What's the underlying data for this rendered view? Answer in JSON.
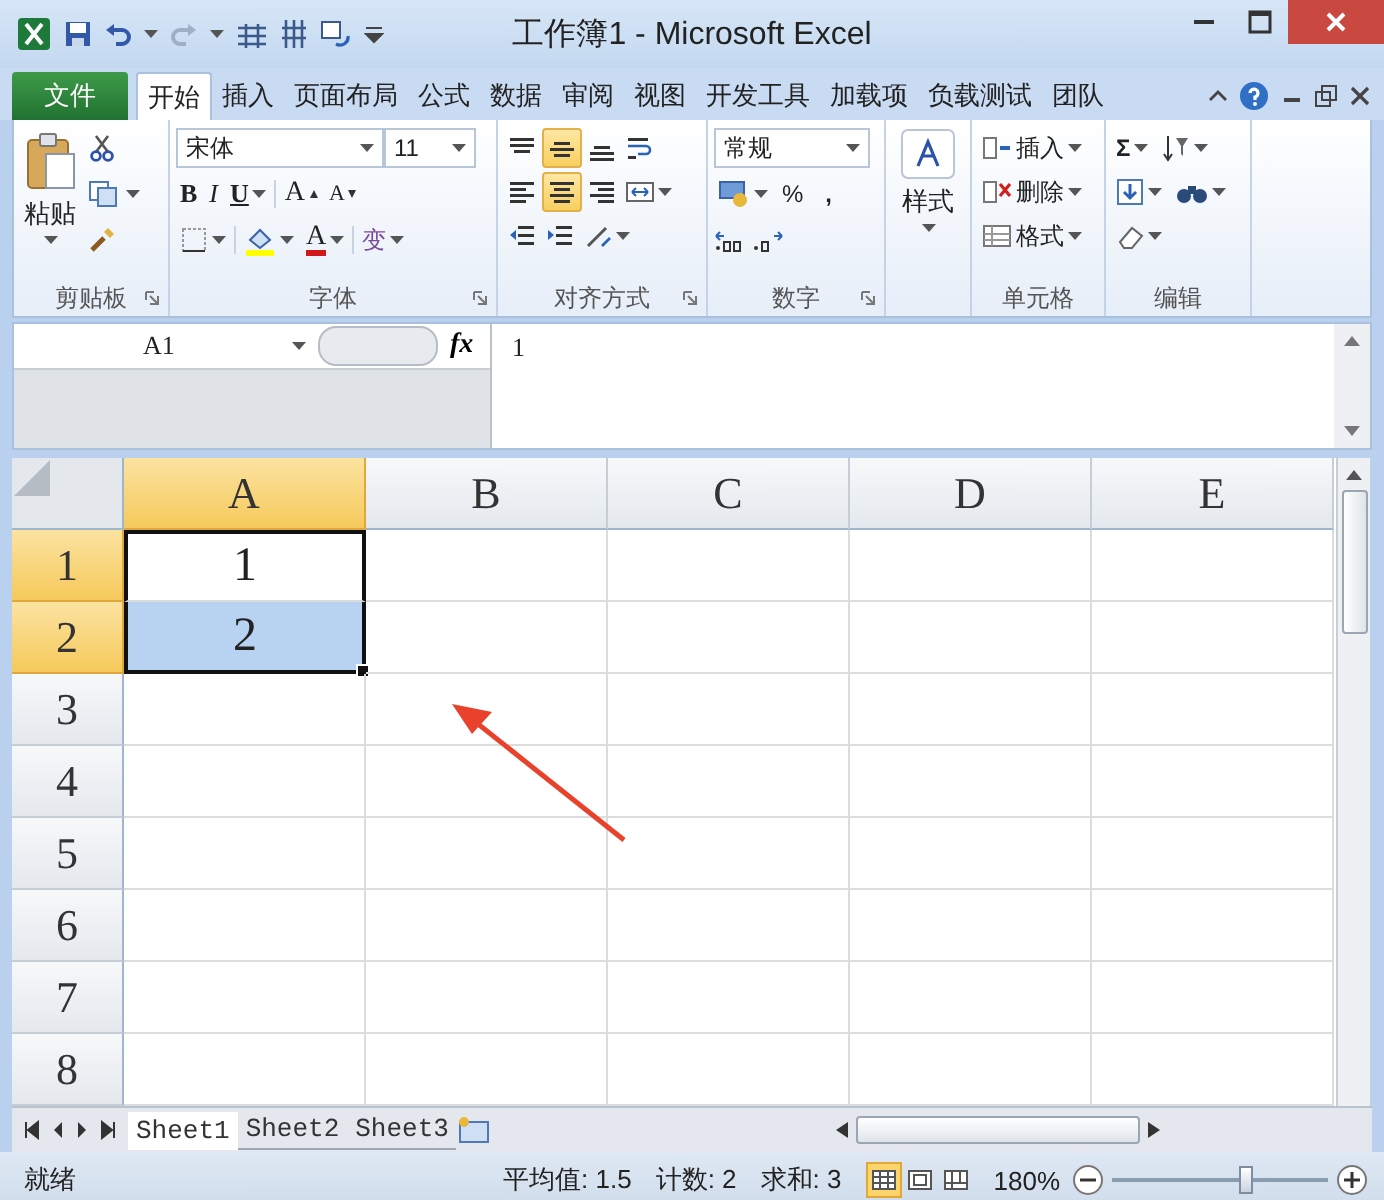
{
  "window": {
    "title": "工作簿1 - Microsoft Excel"
  },
  "file_tab": {
    "label": "文件"
  },
  "tabs": [
    {
      "label": "开始",
      "selected": true
    },
    {
      "label": "插入",
      "selected": false
    },
    {
      "label": "页面布局",
      "selected": false
    },
    {
      "label": "公式",
      "selected": false
    },
    {
      "label": "数据",
      "selected": false
    },
    {
      "label": "审阅",
      "selected": false
    },
    {
      "label": "视图",
      "selected": false
    },
    {
      "label": "开发工具",
      "selected": false
    },
    {
      "label": "加载项",
      "selected": false
    },
    {
      "label": "负载测试",
      "selected": false
    },
    {
      "label": "团队",
      "selected": false
    }
  ],
  "ribbon": {
    "clipboard": {
      "paste": "粘贴",
      "label": "剪贴板"
    },
    "font": {
      "name": "宋体",
      "size": "11",
      "bold": "B",
      "italic": "I",
      "underline": "U",
      "grow": "A",
      "shrink": "A",
      "font_color": "A",
      "phonetic": "变",
      "label": "字体"
    },
    "alignment": {
      "buttons": [
        {
          "kind": "top",
          "selected": false
        },
        {
          "kind": "middle",
          "selected": true
        },
        {
          "kind": "bottom",
          "selected": false
        },
        {
          "kind": "wrap",
          "selected": false
        },
        {
          "kind": "left",
          "selected": false
        },
        {
          "kind": "center",
          "selected": true
        },
        {
          "kind": "right",
          "selected": false
        },
        {
          "kind": "merge",
          "selected": false
        },
        {
          "kind": "outdent",
          "selected": false
        },
        {
          "kind": "indent",
          "selected": false
        },
        {
          "kind": "orientation",
          "selected": false
        }
      ],
      "label": "对齐方式"
    },
    "number": {
      "format": "常规",
      "percent": "%",
      "comma": ",",
      "label": "数字"
    },
    "styles": {
      "button": "样式"
    },
    "cells": {
      "buttons": [
        {
          "kind": "insert",
          "label": "插入"
        },
        {
          "kind": "delete",
          "label": "删除"
        },
        {
          "kind": "format",
          "label": "格式"
        }
      ],
      "label": "单元格"
    },
    "editing": {
      "sum": "Σ",
      "label": "编辑"
    }
  },
  "formula_bar": {
    "name_box": "A1",
    "function_label": "fx",
    "value": "1"
  },
  "sheet": {
    "columns": [
      {
        "label": "A",
        "selected": true
      },
      {
        "label": "B",
        "selected": false
      },
      {
        "label": "C",
        "selected": false
      },
      {
        "label": "D",
        "selected": false
      },
      {
        "label": "E",
        "selected": false
      }
    ],
    "rows": [
      {
        "label": "1",
        "selected": true,
        "values": [
          "1"
        ]
      },
      {
        "label": "2",
        "selected": true,
        "values": [
          "2"
        ]
      },
      {
        "label": "3",
        "selected": false
      },
      {
        "label": "4",
        "selected": false
      },
      {
        "label": "5",
        "selected": false
      },
      {
        "label": "6",
        "selected": false
      },
      {
        "label": "7",
        "selected": false
      },
      {
        "label": "8",
        "selected": false
      }
    ]
  },
  "sheet_tabs": [
    {
      "label": "Sheet1",
      "selected": true
    },
    {
      "label": "Sheet2",
      "selected": false
    },
    {
      "label": "Sheet3",
      "selected": false
    }
  ],
  "status_bar": {
    "ready": "就绪",
    "average": "平均值: 1.5",
    "count": "计数: 2",
    "sum": "求和: 3",
    "views": [
      {
        "kind": "normal",
        "selected": true
      },
      {
        "kind": "layout",
        "selected": false
      },
      {
        "kind": "pagebreak",
        "selected": false
      }
    ],
    "zoom": "180%",
    "zoom_slider": {
      "level": 0.62
    }
  }
}
